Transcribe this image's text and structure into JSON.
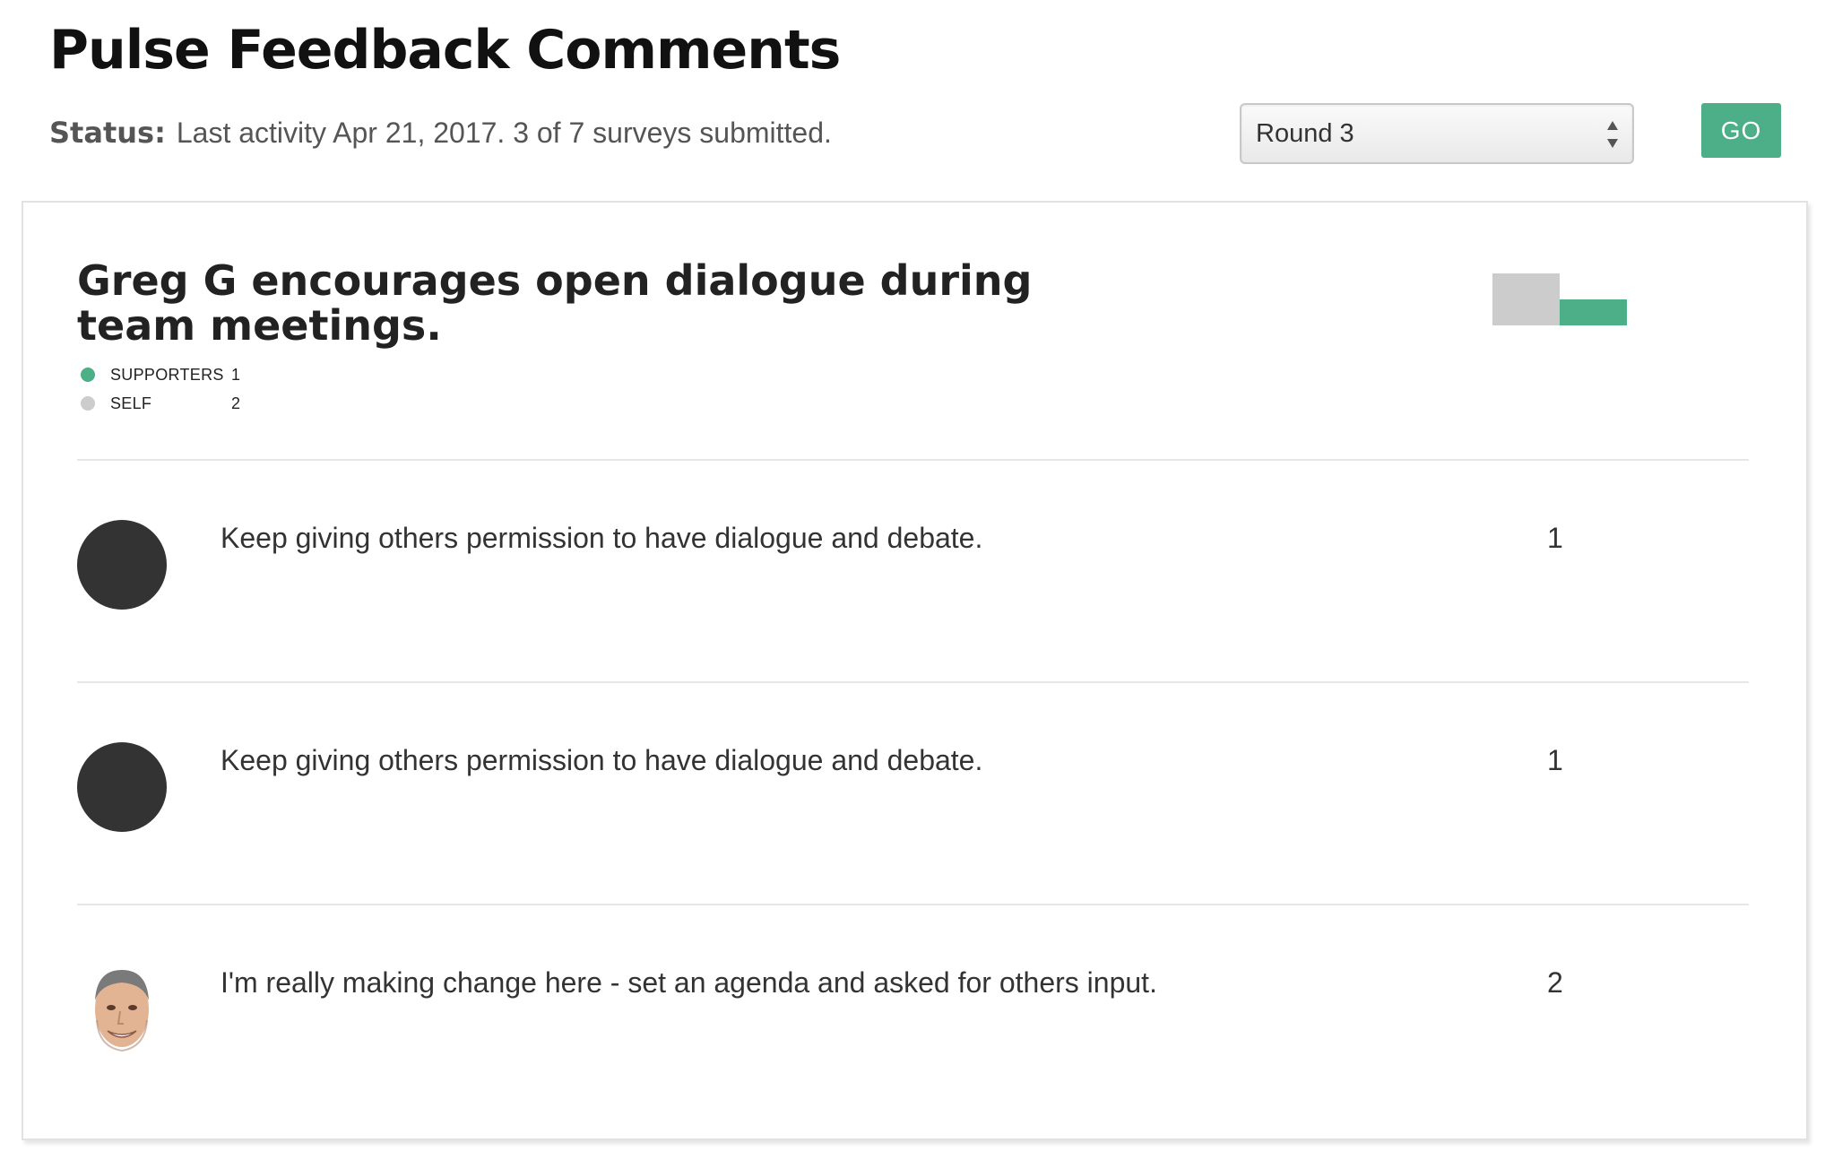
{
  "header": {
    "title": "Pulse Feedback Comments",
    "status_label": "Status:",
    "status_text": "Last activity Apr 21, 2017. 3 of 7 surveys submitted."
  },
  "controls": {
    "round_select_value": "Round 3",
    "go_label": "GO"
  },
  "question": {
    "text": "Greg G encourages open dialogue during team meetings.",
    "legend": [
      {
        "label": "SUPPORTERS",
        "count": "1",
        "color": "#4caf88"
      },
      {
        "label": "SELF",
        "count": "2",
        "color": "#cccccc"
      }
    ]
  },
  "chart_data": {
    "type": "bar",
    "categories": [
      "SELF",
      "SUPPORTERS"
    ],
    "values": [
      2,
      1
    ],
    "colors": [
      "#cccccc",
      "#4caf88"
    ],
    "ylim": [
      0,
      2
    ]
  },
  "comments": [
    {
      "avatar": "dark-circle",
      "text": "Keep giving others permission to have dialogue and debate.",
      "score": "1"
    },
    {
      "avatar": "dark-circle",
      "text": "Keep giving others permission to have dialogue and debate.",
      "score": "1"
    },
    {
      "avatar": "user-photo",
      "text": "I'm really making change here - set an agenda and asked for others input.",
      "score": "2"
    }
  ],
  "colors": {
    "accent": "#4caf88",
    "self": "#cccccc",
    "avatar_dark": "#333333"
  }
}
